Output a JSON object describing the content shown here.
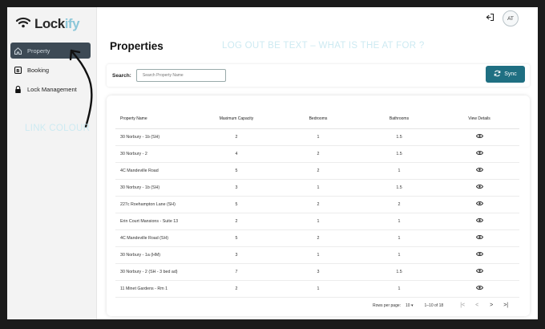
{
  "brand": {
    "logo_text_main": "Lock",
    "logo_text_accent": "ify",
    "icon": "wifi-signal-icon"
  },
  "sidebar": {
    "items": [
      {
        "label": "Property",
        "icon": "home-icon",
        "active": true
      },
      {
        "label": "Booking",
        "icon": "booking-icon",
        "active": false
      },
      {
        "label": "Lock Management",
        "icon": "lock-icon",
        "active": false
      }
    ]
  },
  "topbar": {
    "logout_icon": "logout-icon",
    "avatar_initials": "AT"
  },
  "annotations": {
    "top": "LOG OUT BE TEXT  – WHAT IS THE AT FOR ?",
    "left": "LINK COLOUR"
  },
  "page": {
    "title": "Properties"
  },
  "search": {
    "label": "Search:",
    "placeholder": "Search Property Name",
    "value": ""
  },
  "sync_button": {
    "label": "Sync",
    "icon": "sync-icon"
  },
  "table": {
    "columns": [
      "Property Name",
      "Maximum Capacity",
      "Bedrooms",
      "Bathrooms",
      "View Details"
    ],
    "rows": [
      [
        "30 Norbury - 1b (SH)",
        "2",
        "1",
        "1.5"
      ],
      [
        "30 Norbury - 2",
        "4",
        "2",
        "1.5"
      ],
      [
        "4C Mandeville Road",
        "5",
        "2",
        "1"
      ],
      [
        "30 Norbury - 1b (SH)",
        "3",
        "1",
        "1.5"
      ],
      [
        "227c Roehampton Lane (SH)",
        "5",
        "2",
        "2"
      ],
      [
        "Erin Court Mansions - Suite 13",
        "2",
        "1",
        "1"
      ],
      [
        "4C Mandeville Road (SH)",
        "5",
        "2",
        "1"
      ],
      [
        "30 Norbury - 1a (HM)",
        "3",
        "1",
        "1"
      ],
      [
        "30 Norbury - 2 (SH - 3 bed ad)",
        "7",
        "3",
        "1.5"
      ],
      [
        "11 Minet Gardens - Rm 1",
        "2",
        "1",
        "1"
      ]
    ],
    "view_icon": "eye-icon"
  },
  "pagination": {
    "rows_per_page_label": "Rows per page:",
    "rows_per_page_value": "10",
    "range": "1–10 of 18",
    "first": "|<",
    "prev": "<",
    "next": ">",
    "last": ">|"
  },
  "colors": {
    "accent": "#1f6f82",
    "sidebar_active": "#3d4a55",
    "logo_accent": "#8cc7d9",
    "annotation": "#cdeaf2"
  }
}
